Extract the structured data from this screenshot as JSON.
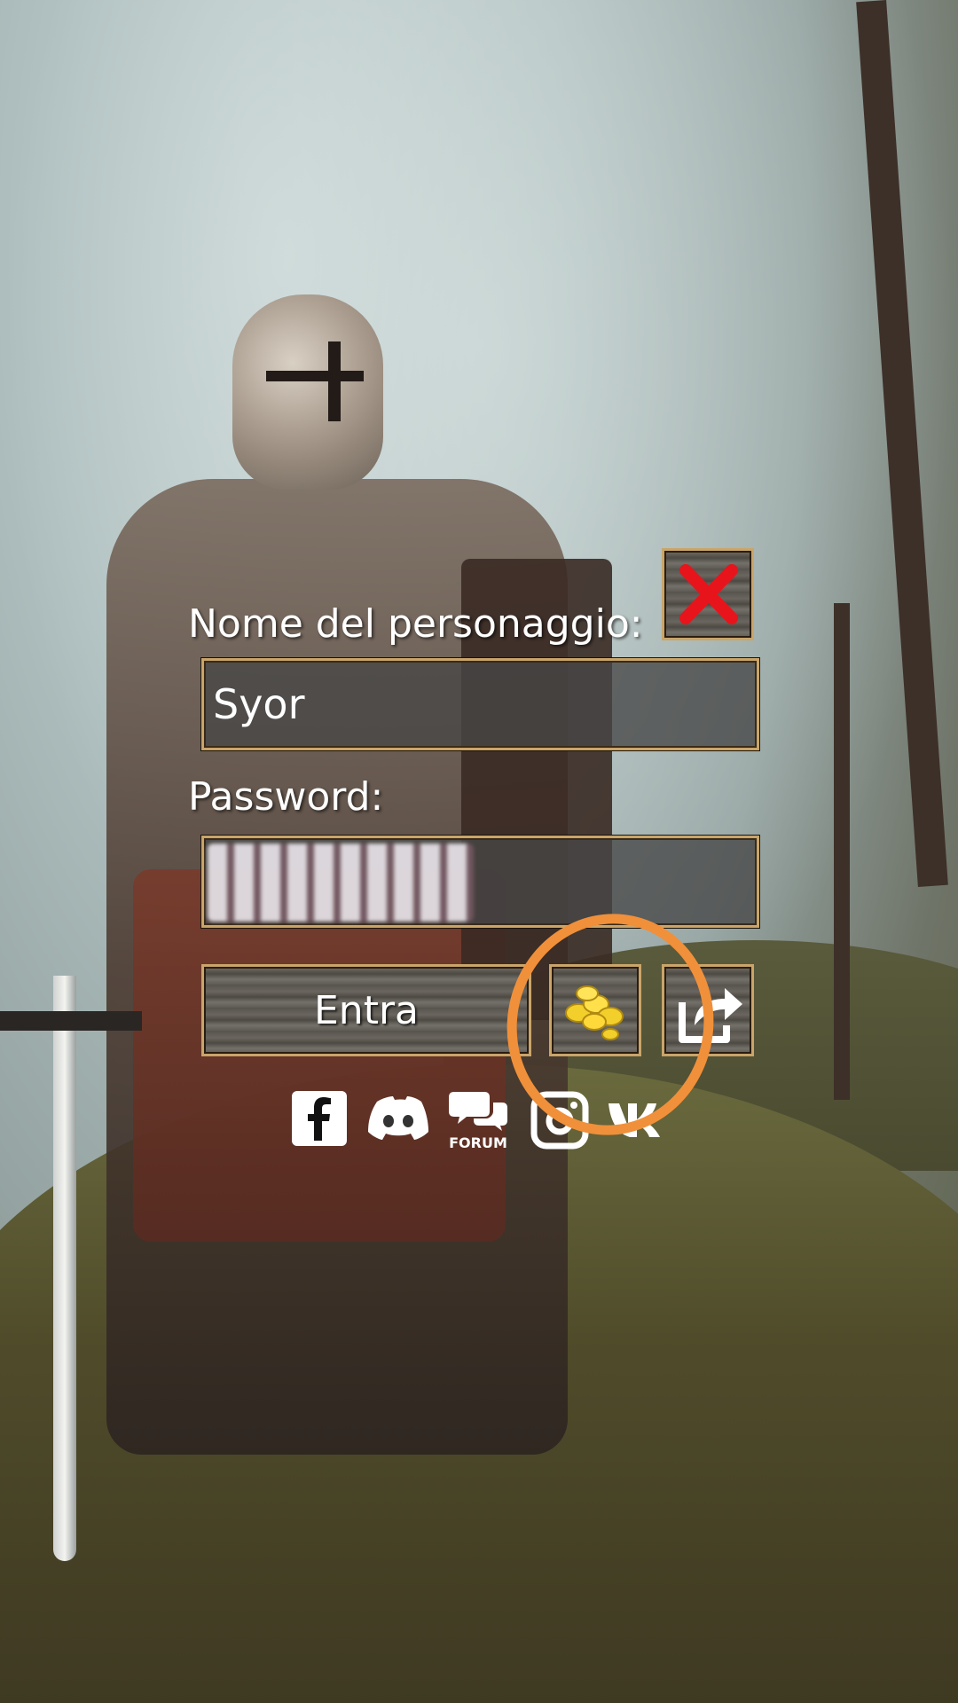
{
  "login": {
    "name_label": "Nome del personaggio:",
    "name_value": "Syor",
    "password_label": "Password:",
    "enter_label": "Entra"
  },
  "social": {
    "forum_label": "FORUM"
  },
  "colors": {
    "frame_gold": "#c9a56a",
    "close_red": "#e8141c",
    "annotation_orange": "#f0903a"
  },
  "icons": [
    "close-icon",
    "gold-coins-icon",
    "share-icon",
    "facebook-icon",
    "discord-icon",
    "forum-icon",
    "instagram-icon",
    "vk-icon"
  ]
}
